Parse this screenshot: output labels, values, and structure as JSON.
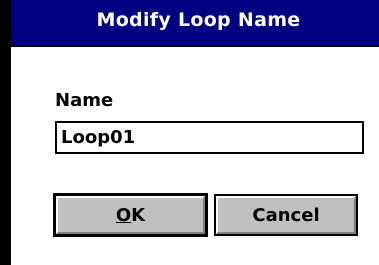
{
  "window": {
    "title": "Modify Loop Name"
  },
  "form": {
    "name_label": "Name",
    "name_value": "Loop01"
  },
  "buttons": {
    "ok_accel": "O",
    "ok_rest": "K",
    "cancel_label": "Cancel"
  },
  "colors": {
    "titlebar": "#000080",
    "button_face": "#c0c0c0"
  }
}
